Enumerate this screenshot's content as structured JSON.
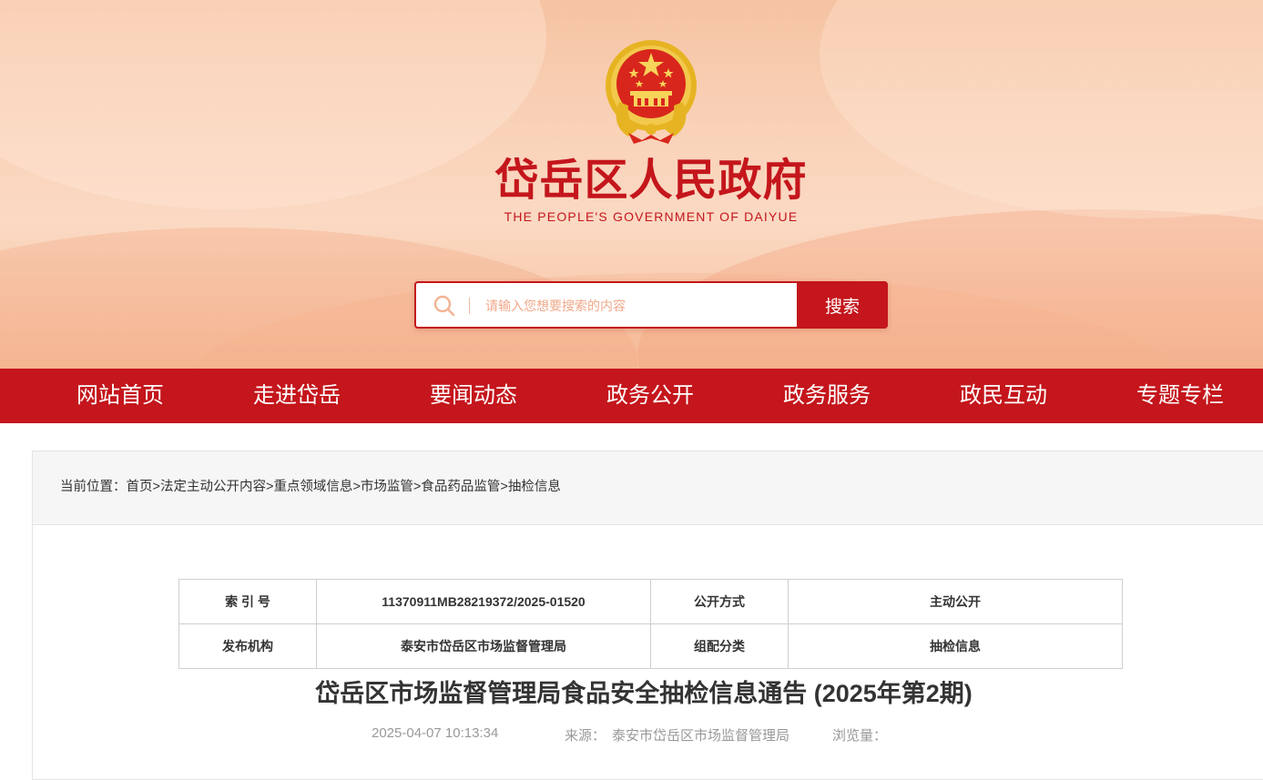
{
  "header": {
    "title": "岱岳区人民政府",
    "subtitle": "THE PEOPLE'S GOVERNMENT OF DAIYUE",
    "emblem_icon": "national-emblem-icon"
  },
  "search": {
    "placeholder": "请输入您想要搜索的内容",
    "button_label": "搜索"
  },
  "nav": {
    "items": [
      {
        "label": "网站首页"
      },
      {
        "label": "走进岱岳"
      },
      {
        "label": "要闻动态"
      },
      {
        "label": "政务公开"
      },
      {
        "label": "政务服务"
      },
      {
        "label": "政民互动"
      },
      {
        "label": "专题专栏"
      }
    ]
  },
  "breadcrumb": {
    "prefix": "当前位置：",
    "items": [
      {
        "label": "首页"
      },
      {
        "label": "法定主动公开内容"
      },
      {
        "label": "重点领域信息"
      },
      {
        "label": "市场监管"
      },
      {
        "label": "食品药品监管"
      },
      {
        "label": "抽检信息"
      }
    ],
    "separator": ">"
  },
  "meta_table": {
    "rows": [
      {
        "k1": "索 引 号",
        "v1": "11370911MB28219372/2025-01520",
        "k2": "公开方式",
        "v2": "主动公开"
      },
      {
        "k1": "发布机构",
        "v1": "泰安市岱岳区市场监督管理局",
        "k2": "组配分类",
        "v2": "抽检信息"
      }
    ]
  },
  "article": {
    "title": "岱岳区市场监督管理局食品安全抽检信息通告 (2025年第2期)",
    "date": "2025-04-07 10:13:34",
    "source_label": "来源：",
    "source_value": "泰安市岱岳区市场监督管理局",
    "views_label": "浏览量："
  },
  "colors": {
    "brand_red": "#c4161c",
    "banner_peach": "#f9d2b8"
  }
}
